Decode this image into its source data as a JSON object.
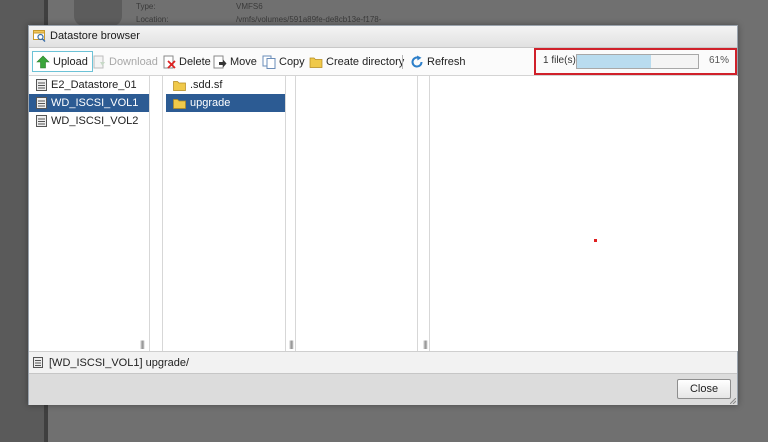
{
  "background": {
    "info_labels": [
      "Type:",
      "Location:"
    ],
    "info_values": [
      "VMFS6",
      "/vmfs/volumes/591a89fe-de8cb13e-f178-"
    ]
  },
  "dialog": {
    "title": "Datastore browser",
    "toolbar": {
      "upload": "Upload",
      "download": "Download",
      "delete": "Delete",
      "move": "Move",
      "copy": "Copy",
      "create_directory": "Create directory",
      "refresh": "Refresh"
    },
    "progress": {
      "files_label": "1 file(s)",
      "percent_text": "61%",
      "fraction": 0.61
    },
    "datastores": [
      {
        "label": "E2_Datastore_01",
        "selected": false
      },
      {
        "label": "WD_ISCSI_VOL1",
        "selected": true
      },
      {
        "label": "WD_ISCSI_VOL2",
        "selected": false
      }
    ],
    "folders": [
      {
        "label": ".sdd.sf",
        "selected": false
      },
      {
        "label": "upgrade",
        "selected": true
      }
    ],
    "current_path": "[WD_ISCSI_VOL1] upgrade/",
    "close_label": "Close"
  },
  "colors": {
    "selection": "#2c5b93",
    "progress_fill": "#b9dcef",
    "highlight_border": "#d0202a",
    "upload_arrow": "#3aa53a",
    "folder": "#f0c94a",
    "refresh_icon": "#2d7fc9"
  }
}
